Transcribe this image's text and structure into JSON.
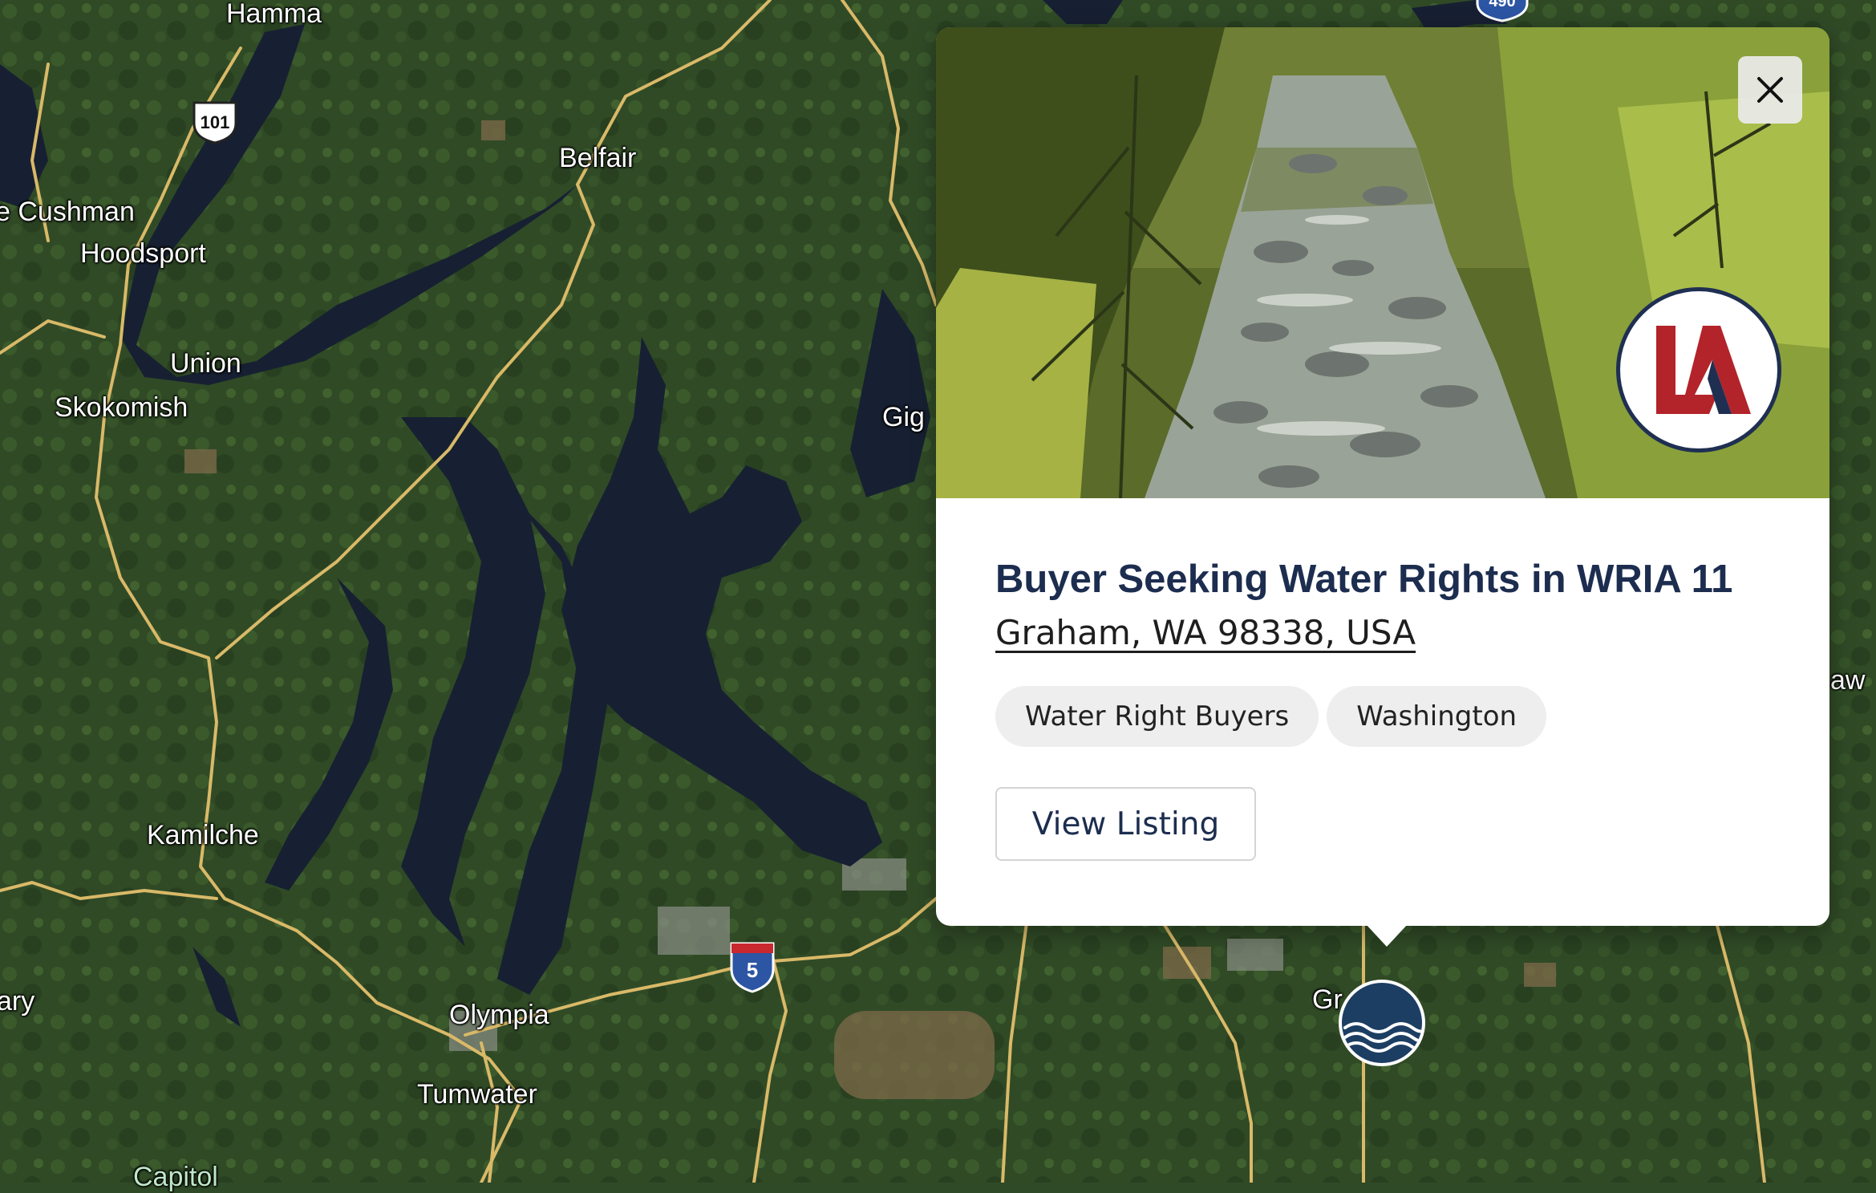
{
  "map": {
    "place_labels": {
      "hamma": "Hamma",
      "cushman": "e Cushman",
      "hoodsport": "Hoodsport",
      "belfair": "Belfair",
      "union": "Union",
      "skokomish": "Skokomish",
      "gig": "Gig",
      "kamilche": "Kamilche",
      "olympia": "Olympia",
      "tumwater": "Tumwater",
      "ary": "ary",
      "capitol": "Capitol",
      "gr": "Gr",
      "aw": "aw"
    },
    "route_shields": {
      "us101": "101",
      "i5": "5",
      "top_partial": "490"
    }
  },
  "popup": {
    "close_icon": "close-icon",
    "logo_text": "LA",
    "title": "Buyer Seeking Water Rights in WRIA 11",
    "address": "Graham, WA 98338, USA",
    "tags": [
      "Water Right Buyers",
      "Washington"
    ],
    "button_label": "View Listing"
  },
  "marker": {
    "icon": "water-waves-icon",
    "color": "#1d3e63"
  },
  "colors": {
    "title": "#1c2d4f",
    "logo_red": "#b3232a",
    "logo_navy": "#1f2f52"
  }
}
